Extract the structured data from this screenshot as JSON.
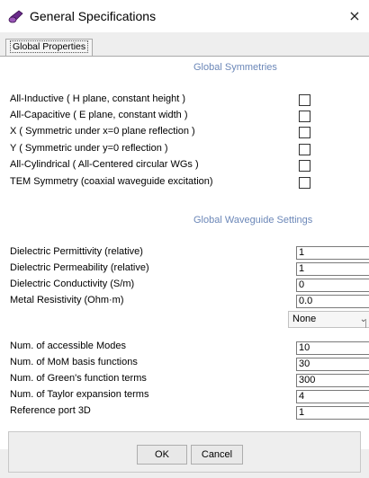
{
  "window": {
    "title": "General Specifications",
    "close_label": "×",
    "icon": "app-icon"
  },
  "tab": {
    "label": "Global Properties"
  },
  "symmetries": {
    "heading": "Global Symmetries",
    "rows": [
      {
        "label": "All-Inductive  ( H plane, constant height )",
        "checked": false
      },
      {
        "label": "All-Capacitive ( E plane, constant width  )",
        "checked": false
      },
      {
        "label": "X ( Symmetric under x=0 plane reflection )",
        "checked": false
      },
      {
        "label": "Y ( Symmetric under y=0 reflection )",
        "checked": false
      },
      {
        "label": "All-Cylindrical ( All-Centered circular WGs )",
        "checked": false
      },
      {
        "label": "TEM Symmetry (coaxial waveguide excitation)",
        "checked": false
      }
    ]
  },
  "waveguide": {
    "heading": "Global Waveguide Settings",
    "fields": [
      {
        "label": "Dielectric Permittivity (relative)",
        "value": "1"
      },
      {
        "label": "Dielectric Permeability (relative)",
        "value": "1"
      },
      {
        "label": "Dielectric Conductivity (S/m)",
        "value": "0"
      },
      {
        "label": "Metal Resistivity (Ohm·m)",
        "value": "0.0"
      }
    ],
    "select_value": "None"
  },
  "numerics": {
    "fields": [
      {
        "label": "Num. of accessible Modes",
        "value": "10"
      },
      {
        "label": "Num. of MoM basis functions",
        "value": "30"
      },
      {
        "label": "Num. of Green's function terms",
        "value": "300"
      },
      {
        "label": "Num. of Taylor expansion terms",
        "value": "4"
      },
      {
        "label": "Reference port 3D",
        "value": "1"
      }
    ]
  },
  "buttons": {
    "ok": "OK",
    "cancel": "Cancel"
  }
}
